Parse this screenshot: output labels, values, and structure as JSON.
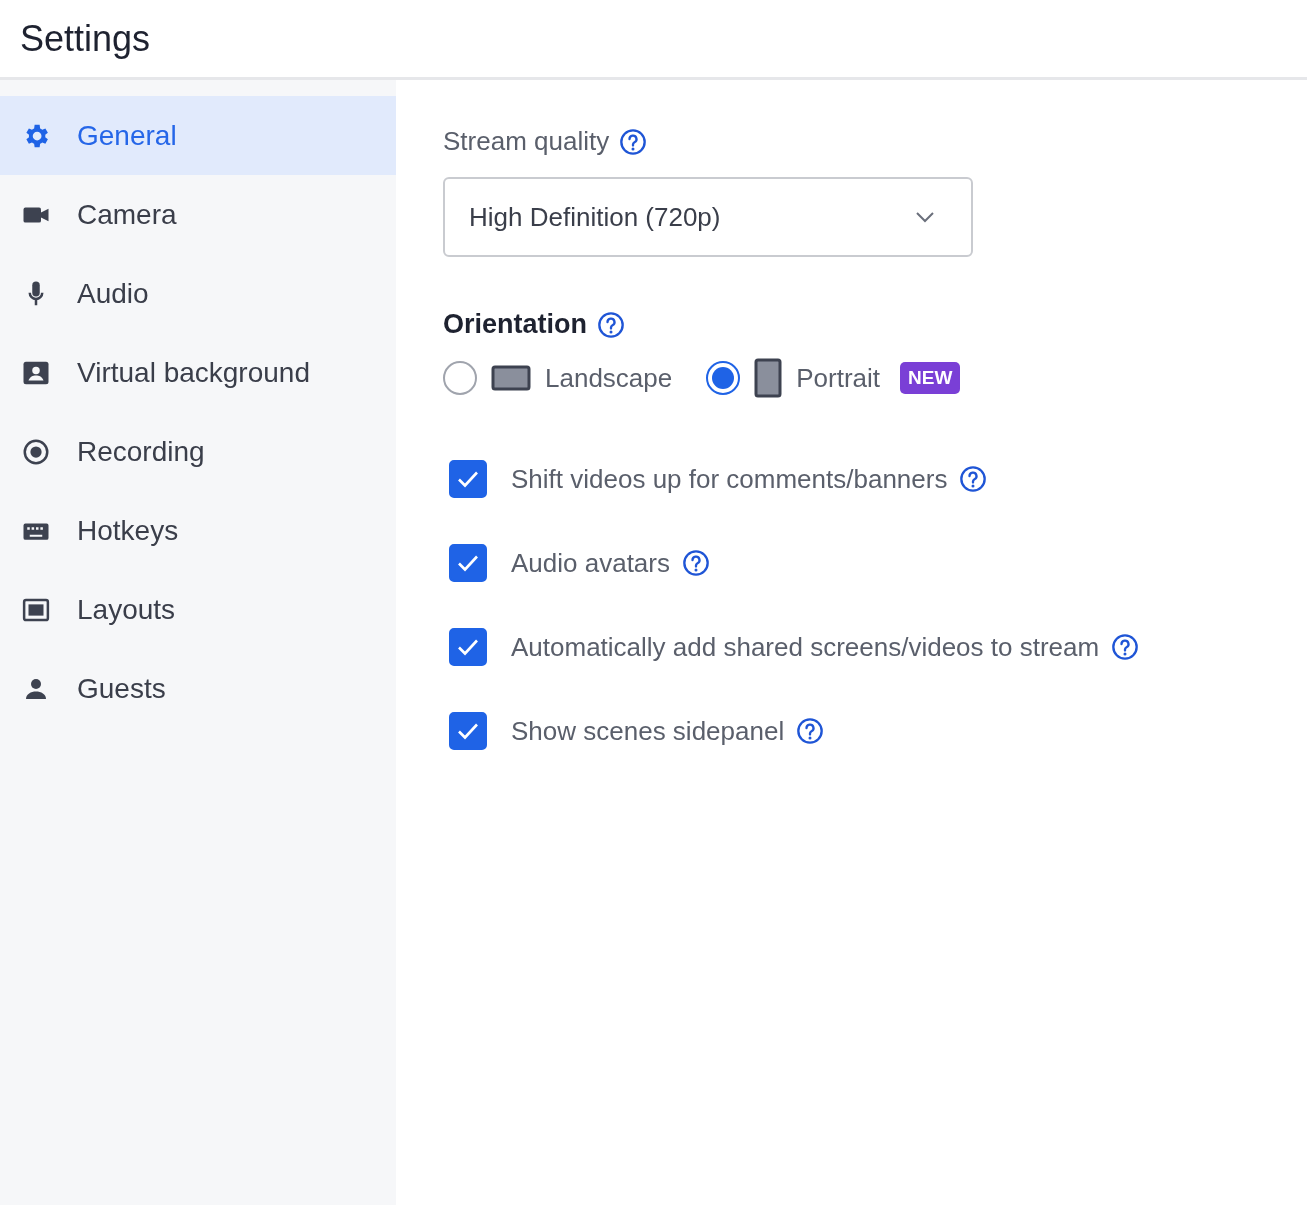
{
  "header": {
    "title": "Settings"
  },
  "sidebar": {
    "items": [
      {
        "label": "General",
        "selected": true
      },
      {
        "label": "Camera",
        "selected": false
      },
      {
        "label": "Audio",
        "selected": false
      },
      {
        "label": "Virtual background",
        "selected": false
      },
      {
        "label": "Recording",
        "selected": false
      },
      {
        "label": "Hotkeys",
        "selected": false
      },
      {
        "label": "Layouts",
        "selected": false
      },
      {
        "label": "Guests",
        "selected": false
      }
    ]
  },
  "stream_quality": {
    "label": "Stream quality",
    "value": "High Definition (720p)"
  },
  "orientation": {
    "label": "Orientation",
    "options": [
      {
        "label": "Landscape",
        "selected": false
      },
      {
        "label": "Portrait",
        "selected": true,
        "badge": "NEW"
      }
    ]
  },
  "options": [
    {
      "label": "Shift videos up for comments/banners",
      "checked": true
    },
    {
      "label": "Audio avatars",
      "checked": true
    },
    {
      "label": "Automatically add shared screens/videos to stream",
      "checked": true
    },
    {
      "label": "Show scenes sidepanel",
      "checked": true
    }
  ]
}
